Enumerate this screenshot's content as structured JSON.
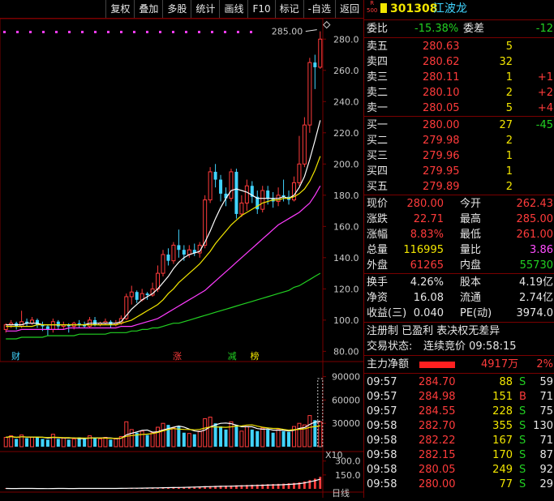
{
  "toolbar": {
    "buttons": [
      "复权",
      "叠加",
      "多股",
      "统计",
      "画线",
      "F10",
      "标记",
      "-自选",
      "返回"
    ]
  },
  "header": {
    "badge_top": "R",
    "badge_bottom": "500",
    "code": "301308",
    "name": "江波龙"
  },
  "commission": {
    "ratio_label": "委比",
    "ratio_value": "-15.38%",
    "diff_label": "委差",
    "diff_value": "-12"
  },
  "asks": [
    {
      "label": "卖五",
      "price": "280.63",
      "vol": "5",
      "chg": ""
    },
    {
      "label": "卖四",
      "price": "280.62",
      "vol": "32",
      "chg": ""
    },
    {
      "label": "卖三",
      "price": "280.11",
      "vol": "1",
      "chg": "+1"
    },
    {
      "label": "卖二",
      "price": "280.10",
      "vol": "2",
      "chg": "+2"
    },
    {
      "label": "卖一",
      "price": "280.05",
      "vol": "5",
      "chg": "+4"
    }
  ],
  "bids": [
    {
      "label": "买一",
      "price": "280.00",
      "vol": "27",
      "chg": "-45"
    },
    {
      "label": "买二",
      "price": "279.98",
      "vol": "2",
      "chg": ""
    },
    {
      "label": "买三",
      "price": "279.96",
      "vol": "1",
      "chg": ""
    },
    {
      "label": "买四",
      "price": "279.95",
      "vol": "1",
      "chg": ""
    },
    {
      "label": "买五",
      "price": "279.89",
      "vol": "2",
      "chg": ""
    }
  ],
  "quote": [
    {
      "l1": "现价",
      "v1": "280.00",
      "c1": "red",
      "l2": "今开",
      "v2": "262.43",
      "c2": "red"
    },
    {
      "l1": "涨跌",
      "v1": "22.71",
      "c1": "red",
      "l2": "最高",
      "v2": "285.00",
      "c2": "red"
    },
    {
      "l1": "涨幅",
      "v1": "8.83%",
      "c1": "red",
      "l2": "最低",
      "v2": "261.00",
      "c2": "red"
    },
    {
      "l1": "总量",
      "v1": "116995",
      "c1": "yellow",
      "l2": "量比",
      "v2": "3.86",
      "c2": "magenta"
    },
    {
      "l1": "外盘",
      "v1": "61265",
      "c1": "red",
      "l2": "内盘",
      "v2": "55730",
      "c2": "green"
    }
  ],
  "fundamentals": [
    {
      "l1": "换手",
      "v1": "4.26%",
      "l2": "股本",
      "v2": "4.19亿"
    },
    {
      "l1": "净资",
      "v1": "16.08",
      "l2": "流通",
      "v2": "2.74亿"
    },
    {
      "l1": "收益(三)",
      "v1": "0.040",
      "l2": "PE(动)",
      "v2": "3974.0"
    }
  ],
  "tags": "注册制 已盈利 表决权无差异",
  "trade_status_label": "交易状态:",
  "trade_status_value": "连续竞价 09:58:15",
  "net_flow": {
    "label": "主力净额",
    "value": "4917万",
    "pct": "2%"
  },
  "ticks": [
    {
      "time": "09:57",
      "price": "284.70",
      "vol": "88",
      "side": "S",
      "n": "59"
    },
    {
      "time": "09:57",
      "price": "284.98",
      "vol": "151",
      "side": "B",
      "n": "71"
    },
    {
      "time": "09:57",
      "price": "284.55",
      "vol": "228",
      "side": "S",
      "n": "75"
    },
    {
      "time": "09:58",
      "price": "282.70",
      "vol": "355",
      "side": "S",
      "n": "130"
    },
    {
      "time": "09:58",
      "price": "282.22",
      "vol": "167",
      "side": "S",
      "n": "71"
    },
    {
      "time": "09:58",
      "price": "282.15",
      "vol": "170",
      "side": "S",
      "n": "87"
    },
    {
      "time": "09:58",
      "price": "280.05",
      "vol": "249",
      "side": "S",
      "n": "92"
    },
    {
      "time": "09:58",
      "price": "280.00",
      "vol": "77",
      "side": "S",
      "n": "29"
    }
  ],
  "chart": {
    "price_axis": [
      "280.0",
      "260.0",
      "240.0",
      "220.0",
      "200.0",
      "180.0",
      "160.0",
      "140.0",
      "120.0",
      "100.0",
      "80.00"
    ],
    "high_label": "285.00",
    "events": [
      {
        "text": "财",
        "color": "#41d4ff",
        "pos": 0.02
      },
      {
        "text": "涨",
        "color": "#ff3b3b",
        "pos": 0.52
      },
      {
        "text": "减",
        "color": "#22d122",
        "pos": 0.69
      },
      {
        "text": "榜",
        "color": "#f2e600",
        "pos": 0.76
      }
    ],
    "volume_axis": [
      "90000",
      "60000",
      "30000"
    ],
    "volume_unit": "X10",
    "indicator_axis": [
      "300.0",
      "150.0"
    ],
    "date_tick": "日线"
  },
  "chart_data": {
    "type": "candlestick",
    "ylim": [
      75,
      290
    ],
    "candles": [
      {
        "o": 94,
        "c": 97,
        "h": 98,
        "l": 92
      },
      {
        "o": 97,
        "c": 98,
        "h": 100,
        "l": 95
      },
      {
        "o": 98,
        "c": 96,
        "h": 99,
        "l": 94
      },
      {
        "o": 96,
        "c": 99,
        "h": 106,
        "l": 95
      },
      {
        "o": 99,
        "c": 98,
        "h": 101,
        "l": 96
      },
      {
        "o": 98,
        "c": 100,
        "h": 102,
        "l": 97
      },
      {
        "o": 100,
        "c": 97,
        "h": 101,
        "l": 95
      },
      {
        "o": 97,
        "c": 96,
        "h": 99,
        "l": 93
      },
      {
        "o": 96,
        "c": 94,
        "h": 97,
        "l": 90
      },
      {
        "o": 94,
        "c": 99,
        "h": 101,
        "l": 92
      },
      {
        "o": 99,
        "c": 96,
        "h": 100,
        "l": 94
      },
      {
        "o": 96,
        "c": 97,
        "h": 99,
        "l": 94
      },
      {
        "o": 97,
        "c": 96,
        "h": 98,
        "l": 92
      },
      {
        "o": 96,
        "c": 98,
        "h": 99,
        "l": 94
      },
      {
        "o": 98,
        "c": 97,
        "h": 100,
        "l": 95
      },
      {
        "o": 97,
        "c": 96,
        "h": 99,
        "l": 95
      },
      {
        "o": 96,
        "c": 100,
        "h": 102,
        "l": 95
      },
      {
        "o": 100,
        "c": 97,
        "h": 102,
        "l": 96
      },
      {
        "o": 97,
        "c": 98,
        "h": 99,
        "l": 96
      },
      {
        "o": 98,
        "c": 99,
        "h": 101,
        "l": 97
      },
      {
        "o": 99,
        "c": 97,
        "h": 100,
        "l": 95
      },
      {
        "o": 97,
        "c": 98,
        "h": 100,
        "l": 96
      },
      {
        "o": 98,
        "c": 101,
        "h": 103,
        "l": 97
      },
      {
        "o": 101,
        "c": 115,
        "h": 117,
        "l": 100
      },
      {
        "o": 115,
        "c": 118,
        "h": 122,
        "l": 110
      },
      {
        "o": 118,
        "c": 113,
        "h": 119,
        "l": 111
      },
      {
        "o": 113,
        "c": 117,
        "h": 120,
        "l": 112
      },
      {
        "o": 117,
        "c": 116,
        "h": 118,
        "l": 113
      },
      {
        "o": 116,
        "c": 120,
        "h": 124,
        "l": 115
      },
      {
        "o": 120,
        "c": 130,
        "h": 135,
        "l": 118
      },
      {
        "o": 130,
        "c": 142,
        "h": 145,
        "l": 128
      },
      {
        "o": 142,
        "c": 138,
        "h": 146,
        "l": 135
      },
      {
        "o": 138,
        "c": 148,
        "h": 150,
        "l": 136
      },
      {
        "o": 148,
        "c": 145,
        "h": 158,
        "l": 140
      },
      {
        "o": 145,
        "c": 142,
        "h": 148,
        "l": 138
      },
      {
        "o": 142,
        "c": 145,
        "h": 148,
        "l": 140
      },
      {
        "o": 145,
        "c": 143,
        "h": 149,
        "l": 141
      },
      {
        "o": 143,
        "c": 148,
        "h": 150,
        "l": 140
      },
      {
        "o": 148,
        "c": 177,
        "h": 180,
        "l": 146
      },
      {
        "o": 177,
        "c": 195,
        "h": 198,
        "l": 175
      },
      {
        "o": 195,
        "c": 190,
        "h": 200,
        "l": 185
      },
      {
        "o": 190,
        "c": 181,
        "h": 193,
        "l": 176
      },
      {
        "o": 181,
        "c": 178,
        "h": 185,
        "l": 173
      },
      {
        "o": 178,
        "c": 195,
        "h": 197,
        "l": 176
      },
      {
        "o": 195,
        "c": 168,
        "h": 197,
        "l": 165
      },
      {
        "o": 168,
        "c": 175,
        "h": 180,
        "l": 166
      },
      {
        "o": 175,
        "c": 186,
        "h": 190,
        "l": 170
      },
      {
        "o": 186,
        "c": 179,
        "h": 189,
        "l": 175
      },
      {
        "o": 179,
        "c": 171,
        "h": 183,
        "l": 168
      },
      {
        "o": 171,
        "c": 183,
        "h": 186,
        "l": 169
      },
      {
        "o": 183,
        "c": 178,
        "h": 186,
        "l": 174
      },
      {
        "o": 178,
        "c": 176,
        "h": 182,
        "l": 172
      },
      {
        "o": 176,
        "c": 180,
        "h": 185,
        "l": 173
      },
      {
        "o": 180,
        "c": 179,
        "h": 190,
        "l": 176
      },
      {
        "o": 179,
        "c": 177,
        "h": 183,
        "l": 174
      },
      {
        "o": 177,
        "c": 188,
        "h": 192,
        "l": 176
      },
      {
        "o": 188,
        "c": 200,
        "h": 218,
        "l": 186
      },
      {
        "o": 200,
        "c": 225,
        "h": 230,
        "l": 198
      },
      {
        "o": 225,
        "c": 265,
        "h": 268,
        "l": 220
      },
      {
        "o": 265,
        "c": 262,
        "h": 270,
        "l": 248
      },
      {
        "o": 262,
        "c": 280,
        "h": 285,
        "l": 261
      }
    ],
    "ma_fast": [
      97,
      97,
      97,
      97,
      98,
      98,
      98,
      97,
      97,
      97,
      97,
      97,
      97,
      97,
      97,
      97,
      98,
      98,
      98,
      98,
      98,
      98,
      99,
      103,
      107,
      110,
      113,
      115,
      117,
      120,
      124,
      128,
      133,
      137,
      140,
      142,
      143,
      144,
      150,
      157,
      165,
      172,
      178,
      183,
      184,
      183,
      182,
      180,
      178,
      178,
      178,
      178,
      178,
      179,
      178,
      180,
      185,
      192,
      203,
      215,
      228
    ],
    "ma_mid": [
      96,
      96,
      96,
      96,
      96,
      96,
      97,
      97,
      97,
      97,
      97,
      97,
      97,
      97,
      97,
      97,
      97,
      97,
      97,
      97,
      97,
      97,
      98,
      99,
      100,
      102,
      104,
      106,
      108,
      110,
      113,
      117,
      120,
      124,
      127,
      130,
      133,
      136,
      140,
      144,
      149,
      153,
      157,
      161,
      164,
      167,
      169,
      171,
      173,
      175,
      176,
      177,
      177,
      178,
      178,
      179,
      181,
      184,
      189,
      196,
      205
    ],
    "ma_slow": [
      93,
      93,
      93,
      94,
      94,
      94,
      94,
      94,
      94,
      94,
      94,
      94,
      95,
      95,
      95,
      95,
      95,
      95,
      95,
      95,
      95,
      95,
      96,
      96,
      96,
      97,
      98,
      99,
      100,
      101,
      103,
      105,
      107,
      109,
      111,
      113,
      115,
      117,
      119,
      122,
      125,
      128,
      131,
      134,
      137,
      140,
      143,
      146,
      149,
      152,
      155,
      158,
      161,
      163,
      165,
      167,
      169,
      172,
      175,
      180,
      186
    ],
    "ma_long": [
      88,
      88,
      88,
      89,
      89,
      89,
      89,
      89,
      90,
      90,
      90,
      90,
      90,
      90,
      91,
      91,
      91,
      91,
      91,
      91,
      92,
      92,
      92,
      92,
      93,
      93,
      94,
      94,
      95,
      95,
      96,
      97,
      98,
      98,
      99,
      100,
      101,
      102,
      103,
      104,
      105,
      106,
      107,
      108,
      109,
      110,
      111,
      112,
      113,
      114,
      115,
      116,
      117,
      118,
      119,
      121,
      122,
      124,
      126,
      128,
      130
    ],
    "volume": [
      12,
      14,
      10,
      15,
      11,
      12,
      13,
      10,
      9,
      16,
      10,
      11,
      9,
      10,
      12,
      10,
      14,
      11,
      10,
      12,
      9,
      10,
      13,
      32,
      22,
      18,
      20,
      15,
      18,
      25,
      30,
      28,
      24,
      26,
      18,
      17,
      16,
      20,
      36,
      38,
      30,
      26,
      22,
      32,
      28,
      20,
      26,
      22,
      20,
      24,
      22,
      18,
      22,
      20,
      19,
      26,
      30,
      28,
      40,
      34,
      32
    ],
    "volume_ylim": [
      0,
      100000
    ],
    "indicator": [
      5,
      4,
      4,
      5,
      6,
      5,
      4,
      4,
      3,
      4,
      5,
      5,
      4,
      4,
      5,
      5,
      6,
      6,
      5,
      5,
      6,
      6,
      7,
      8,
      9,
      9,
      10,
      11,
      12,
      13,
      15,
      16,
      18,
      19,
      20,
      22,
      24,
      26,
      28,
      30,
      32,
      34,
      35,
      36,
      38,
      40,
      42,
      44,
      46,
      48,
      50,
      52,
      54,
      56,
      60,
      64,
      70,
      80,
      95,
      110,
      130
    ],
    "indicator_ylim": [
      0,
      350
    ]
  }
}
